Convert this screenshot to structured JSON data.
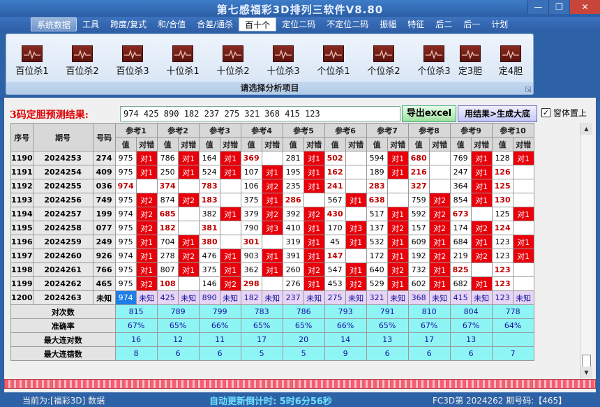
{
  "title": "第七感福彩3D排列三软件V8.80",
  "window_buttons": [
    "—",
    "❐",
    "✕"
  ],
  "menu": [
    "系统数据",
    "工具",
    "跨度/复式",
    "和/合值",
    "合差/通杀",
    "百十个",
    "定位二码",
    "不定位二码",
    "振幅",
    "特征",
    "后二",
    "后一",
    "计划"
  ],
  "ribbon": {
    "buttons": [
      "百位杀1",
      "百位杀2",
      "百位杀3",
      "十位杀1",
      "十位杀2",
      "十位杀3",
      "个位杀1",
      "个位杀2",
      "个位杀3",
      "定3胆",
      "定4胆"
    ],
    "caption": "请选择分析项目"
  },
  "prediction": {
    "label": "3码定胆预测结果:",
    "value": "974 425 890 182 237 275 321 368 415 123",
    "export_label": "导出excel",
    "result_label": "用结果>生成大底",
    "topmost_label": "窗体置上",
    "topmost_checked": "✓"
  },
  "table": {
    "head_fixed": [
      "序号",
      "期号",
      "号码"
    ],
    "refs": [
      "参考1",
      "参考2",
      "参考3",
      "参考4",
      "参考5",
      "参考6",
      "参考7",
      "参考8",
      "参考9",
      "参考10"
    ],
    "sub": [
      "值",
      "对错"
    ],
    "rows": [
      {
        "seq": "1190",
        "issue": "2024253",
        "num": "274",
        "cells": [
          [
            "975",
            "对1"
          ],
          [
            "786",
            "对1"
          ],
          [
            "164",
            "对1"
          ],
          [
            "369",
            ""
          ],
          [
            "281",
            "对1"
          ],
          [
            "502",
            ""
          ],
          [
            "594",
            "对1"
          ],
          [
            "680",
            ""
          ],
          [
            "769",
            "对1"
          ],
          [
            "128",
            "对1"
          ]
        ]
      },
      {
        "seq": "1191",
        "issue": "2024254",
        "num": "409",
        "cells": [
          [
            "975",
            "对1"
          ],
          [
            "250",
            "对1"
          ],
          [
            "524",
            "对1"
          ],
          [
            "107",
            "对1"
          ],
          [
            "195",
            "对1"
          ],
          [
            "162",
            ""
          ],
          [
            "189",
            "对1"
          ],
          [
            "216",
            ""
          ],
          [
            "247",
            "对1"
          ],
          [
            "126",
            ""
          ]
        ]
      },
      {
        "seq": "1192",
        "issue": "2024255",
        "num": "036",
        "cells": [
          [
            "974",
            ""
          ],
          [
            "374",
            ""
          ],
          [
            "783",
            ""
          ],
          [
            "106",
            "对2"
          ],
          [
            "235",
            "对1"
          ],
          [
            "241",
            ""
          ],
          [
            "283",
            ""
          ],
          [
            "327",
            ""
          ],
          [
            "364",
            "对1"
          ],
          [
            "125",
            ""
          ]
        ]
      },
      {
        "seq": "1193",
        "issue": "2024256",
        "num": "749",
        "cells": [
          [
            "975",
            "对2"
          ],
          [
            "874",
            "对2"
          ],
          [
            "183",
            ""
          ],
          [
            "375",
            "对1"
          ],
          [
            "286",
            ""
          ],
          [
            "567",
            "对1"
          ],
          [
            "638",
            ""
          ],
          [
            "759",
            "对2"
          ],
          [
            "854",
            "对1"
          ],
          [
            "130",
            ""
          ]
        ]
      },
      {
        "seq": "1194",
        "issue": "2024257",
        "num": "199",
        "cells": [
          [
            "974",
            "对2"
          ],
          [
            "685",
            ""
          ],
          [
            "382",
            "对1"
          ],
          [
            "379",
            "对2"
          ],
          [
            "392",
            "对2"
          ],
          [
            "430",
            ""
          ],
          [
            "517",
            "对1"
          ],
          [
            "592",
            "对2"
          ],
          [
            "673",
            ""
          ],
          [
            "125",
            "对1"
          ]
        ]
      },
      {
        "seq": "1195",
        "issue": "2024258",
        "num": "077",
        "cells": [
          [
            "975",
            "对2"
          ],
          [
            "182",
            ""
          ],
          [
            "381",
            ""
          ],
          [
            "790",
            "对3"
          ],
          [
            "410",
            "对1"
          ],
          [
            "170",
            "对3"
          ],
          [
            "137",
            "对2"
          ],
          [
            "157",
            "对2"
          ],
          [
            "174",
            "对2"
          ],
          [
            "124",
            ""
          ]
        ]
      },
      {
        "seq": "1196",
        "issue": "2024259",
        "num": "249",
        "cells": [
          [
            "975",
            "对1"
          ],
          [
            "704",
            "对1"
          ],
          [
            "380",
            ""
          ],
          [
            "301",
            ""
          ],
          [
            "319",
            "对1"
          ],
          [
            "45",
            "对1"
          ],
          [
            "532",
            "对1"
          ],
          [
            "609",
            "对1"
          ],
          [
            "684",
            "对1"
          ],
          [
            "123",
            "对1"
          ]
        ]
      },
      {
        "seq": "1197",
        "issue": "2024260",
        "num": "926",
        "cells": [
          [
            "974",
            "对1"
          ],
          [
            "278",
            "对2"
          ],
          [
            "476",
            "对1"
          ],
          [
            "903",
            "对1"
          ],
          [
            "391",
            "对1"
          ],
          [
            "147",
            ""
          ],
          [
            "172",
            "对1"
          ],
          [
            "192",
            "对2"
          ],
          [
            "219",
            "对2"
          ],
          [
            "123",
            "对1"
          ]
        ]
      },
      {
        "seq": "1198",
        "issue": "2024261",
        "num": "766",
        "cells": [
          [
            "975",
            "对1"
          ],
          [
            "807",
            "对1"
          ],
          [
            "375",
            "对1"
          ],
          [
            "362",
            "对1"
          ],
          [
            "260",
            "对2"
          ],
          [
            "547",
            "对1"
          ],
          [
            "640",
            "对2"
          ],
          [
            "732",
            "对1"
          ],
          [
            "825",
            ""
          ],
          [
            "123",
            ""
          ]
        ]
      },
      {
        "seq": "1199",
        "issue": "2024262",
        "num": "465",
        "cells": [
          [
            "975",
            "对2"
          ],
          [
            "108",
            ""
          ],
          [
            "146",
            "对2"
          ],
          [
            "298",
            ""
          ],
          [
            "276",
            "对1"
          ],
          [
            "453",
            "对2"
          ],
          [
            "529",
            "对1"
          ],
          [
            "602",
            "对1"
          ],
          [
            "682",
            "对1"
          ],
          [
            "123",
            ""
          ]
        ]
      }
    ],
    "pred_row": {
      "seq": "1200",
      "issue": "2024263",
      "num": "未知",
      "cells": [
        [
          "974",
          "未知"
        ],
        [
          "425",
          "未知"
        ],
        [
          "890",
          "未知"
        ],
        [
          "182",
          "未知"
        ],
        [
          "237",
          "未知"
        ],
        [
          "275",
          "未知"
        ],
        [
          "321",
          "未知"
        ],
        [
          "368",
          "未知"
        ],
        [
          "415",
          "未知"
        ],
        [
          "123",
          "未知"
        ]
      ]
    },
    "stats": [
      {
        "label": "对次数",
        "vals": [
          "815",
          "789",
          "799",
          "783",
          "786",
          "793",
          "791",
          "810",
          "804",
          "778"
        ]
      },
      {
        "label": "准确率",
        "vals": [
          "67%",
          "65%",
          "66%",
          "65%",
          "65%",
          "66%",
          "65%",
          "67%",
          "67%",
          "64%"
        ]
      },
      {
        "label": "最大连对数",
        "vals": [
          "16",
          "12",
          "11",
          "17",
          "20",
          "14",
          "13",
          "17",
          "13",
          ""
        ]
      },
      {
        "label": "最大连错数",
        "vals": [
          "8",
          "6",
          "6",
          "5",
          "5",
          "9",
          "6",
          "6",
          "6",
          "7"
        ]
      }
    ]
  },
  "status": {
    "left": "当前为:[福彩3D] 数据",
    "mid": "自动更新倒计时: 5时6分56秒",
    "right": "FC3D第 2024262 期号码:【465】"
  },
  "colors": {
    "hit": "#e8000a",
    "pred": "#e8d4f4",
    "stat": "#8ff4f4",
    "bar": "#2e62a6"
  }
}
